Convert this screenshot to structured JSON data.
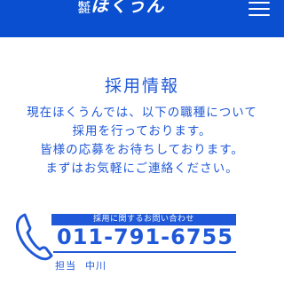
{
  "header": {
    "logo_prefix": "株式会社",
    "logo_main": "ほくうん",
    "menu_icon": "hamburger-menu-icon",
    "bg_color": "#0a4fcf"
  },
  "content": {
    "title": "採用情報",
    "intro_lines": [
      "現在ほくうんでは、以下の職種について",
      "採用を行っております。",
      "皆様の応募をお待ちしております。",
      "まずはお気軽にご連絡ください。"
    ],
    "text_color": "#1f58d8"
  },
  "contact": {
    "icon": "phone-handset-icon",
    "label": "採用に関するお問い合わせ",
    "phone": "011-791-6755",
    "person_label": "担当",
    "person_name": "中川"
  }
}
